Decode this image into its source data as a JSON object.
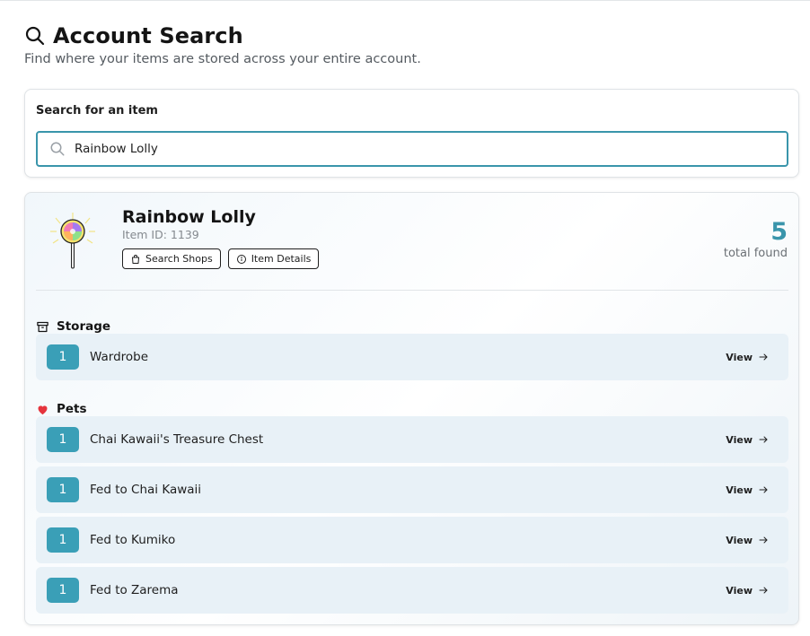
{
  "header": {
    "title": "Account Search",
    "subtitle": "Find where your items are stored across your entire account."
  },
  "search": {
    "label": "Search for an item",
    "value": "Rainbow Lolly",
    "icon": "search-icon"
  },
  "item": {
    "name": "Rainbow Lolly",
    "id_text": "Item ID: 1139",
    "buttons": {
      "search_shops": "Search Shops",
      "item_details": "Item Details"
    },
    "total_count": "5",
    "total_label": "total found"
  },
  "sections": [
    {
      "title": "Storage",
      "icon": "archive-box-icon",
      "rows": [
        {
          "count": "1",
          "label": "Wardrobe",
          "action": "View"
        }
      ]
    },
    {
      "title": "Pets",
      "icon": "heart-icon",
      "accent": "#e5343d",
      "rows": [
        {
          "count": "1",
          "label": "Chai Kawaii's Treasure Chest",
          "action": "View"
        },
        {
          "count": "1",
          "label": "Fed to Chai Kawaii",
          "action": "View"
        },
        {
          "count": "1",
          "label": "Fed to Kumiko",
          "action": "View"
        },
        {
          "count": "1",
          "label": "Fed to Zarema",
          "action": "View"
        }
      ]
    }
  ],
  "colors": {
    "accent": "#3a95ab",
    "badge": "#3a9fb7",
    "row_bg": "#e8f1f7"
  }
}
